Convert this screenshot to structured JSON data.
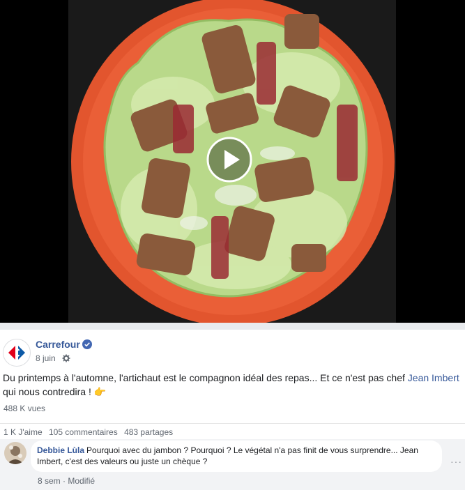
{
  "video": {
    "description_icon": "play-icon"
  },
  "post": {
    "page_name": "Carrefour",
    "date": "8 juin",
    "text_before": "Du printemps à l'automne, l'artichaut est le compagnon idéal des repas... Et ce n'est pas chef ",
    "mention": "Jean Imbert",
    "text_after": " qui nous contredira ! 👉",
    "views": "488 K vues",
    "likes": "1 K J'aime",
    "comments_count": "105 commentaires",
    "shares": "483 partages"
  },
  "comment": {
    "author": "Debbie Lùla",
    "text": "Pourquoi avec du jambon ? Pourquoi ? Le végétal n'a pas finit de vous surprendre... Jean Imbert, c'est des valeurs ou juste un chèque ?",
    "time": "8 sem",
    "separator": "·",
    "edited": "Modifié",
    "more": "···"
  },
  "colors": {
    "link": "#365899",
    "brand_red": "#e2001a",
    "brand_blue": "#0d5aa7",
    "verified": "#4267b2"
  }
}
